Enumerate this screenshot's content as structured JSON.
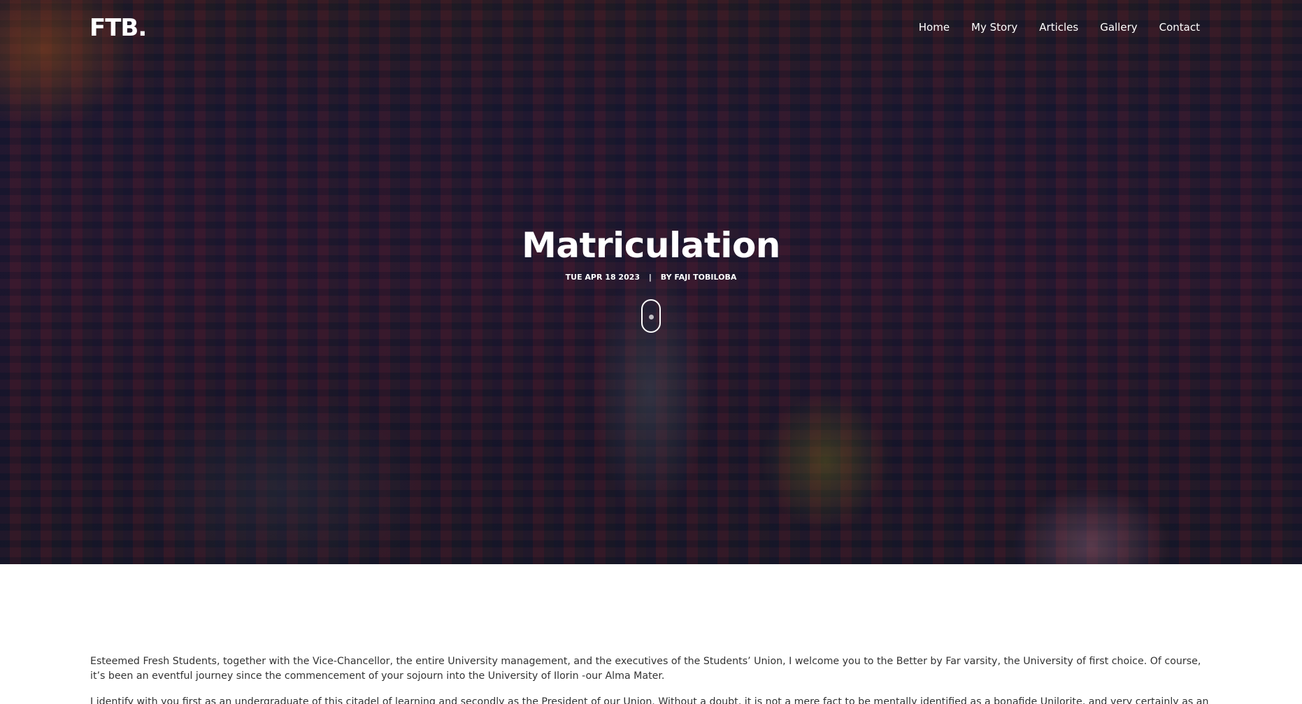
{
  "site": {
    "logo": "FTB."
  },
  "nav": {
    "items": [
      {
        "label": "Home"
      },
      {
        "label": "My Story"
      },
      {
        "label": "Articles"
      },
      {
        "label": "Gallery"
      },
      {
        "label": "Contact"
      }
    ]
  },
  "hero": {
    "title": "Matriculation",
    "date": "TUE APR 18 2023",
    "separator": "|",
    "author": "BY FAJI TOBILOBA"
  },
  "article": {
    "paragraphs": [
      "Esteemed Fresh Students, together with the Vice-Chancellor, the entire University management, and the executives of the Students’ Union, I welcome you to the Better by Far varsity, the University of first choice. Of course, it’s been an eventful journey since the commencement of your sojourn into the University of Ilorin -our Alma Mater.",
      "I identify with you first as an undergraduate of this citadel of learning and secondly as the President of our Union. Without a doubt, it is not a mere fact to be mentally identified as a bonafide Unilorite, and very certainly as an accomplished member of this community"
    ]
  },
  "colors": {
    "overlay": "#000000",
    "text_on_image": "#ffffff",
    "body_text": "#333333"
  }
}
